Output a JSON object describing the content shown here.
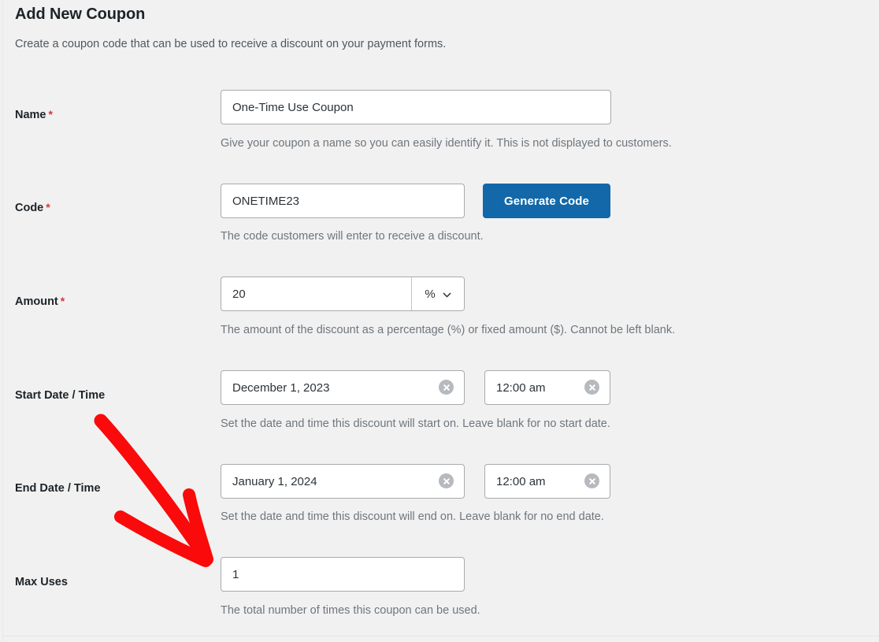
{
  "page": {
    "title": "Add New Coupon",
    "subtitle": "Create a coupon code that can be used to receive a discount on your payment forms."
  },
  "colors": {
    "background": "#f1f1f1",
    "field_border": "#a7aaad",
    "primary_button": "#1268a8",
    "required_asterisk": "#d63638",
    "help_text": "#6f767d",
    "annotation_arrow": "#fa0a0a"
  },
  "fields": {
    "name": {
      "label": "Name",
      "required": "*",
      "value": "One-Time Use Coupon",
      "help": "Give your coupon a name so you can easily identify it. This is not displayed to customers."
    },
    "code": {
      "label": "Code",
      "required": "*",
      "value": "ONETIME23",
      "help": "The code customers will enter to receive a discount.",
      "generate_button": "Generate Code"
    },
    "amount": {
      "label": "Amount",
      "required": "*",
      "value": "20",
      "unit": "%",
      "unit_options": [
        "%",
        "$"
      ],
      "help": "The amount of the discount as a percentage (%) or fixed amount ($). Cannot be left blank."
    },
    "start_date_time": {
      "label": "Start Date / Time",
      "date_value": "December 1, 2023",
      "time_value": "12:00 am",
      "help": "Set the date and time this discount will start on. Leave blank for no start date."
    },
    "end_date_time": {
      "label": "End Date / Time",
      "date_value": "January 1, 2024",
      "time_value": "12:00 am",
      "help": "Set the date and time this discount will end on. Leave blank for no end date."
    },
    "max_uses": {
      "label": "Max Uses",
      "value": "1",
      "help": "The total number of times this coupon can be used."
    }
  },
  "annotation": {
    "type": "arrow",
    "description": "red hand-drawn arrow pointing to the Max Uses field",
    "color": "#fa0a0a"
  }
}
